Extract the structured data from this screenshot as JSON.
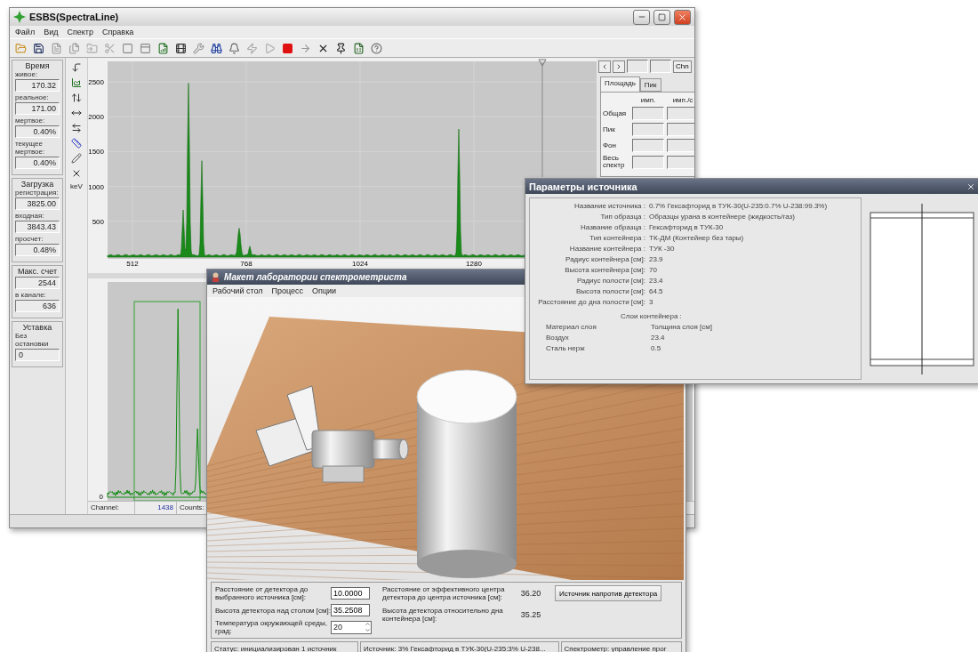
{
  "main_window": {
    "title": "ESBS(SpectraLine)",
    "menu": [
      "Файл",
      "Вид",
      "Спектр",
      "Справка"
    ],
    "left_panel": {
      "groups": [
        {
          "title": "Время",
          "fields": [
            {
              "label": "живое:",
              "value": "170.32"
            },
            {
              "label": "реальное:",
              "value": "171.00"
            },
            {
              "label": "мертвое:",
              "value": "0.40%"
            },
            {
              "label": "текущее мертвое:",
              "value": "0.40%"
            }
          ]
        },
        {
          "title": "Загрузка",
          "fields": [
            {
              "label": "регистрация:",
              "value": "3825.00"
            },
            {
              "label": "входная:",
              "value": "3843.43"
            },
            {
              "label": "просчет:",
              "value": "0.48%"
            }
          ]
        },
        {
          "title": "Макс. счет",
          "fields": [
            {
              "value": "2544"
            },
            {
              "label": "в канале:",
              "value": "636"
            }
          ]
        },
        {
          "title": "Уставка",
          "fields": [
            {
              "label": "Без остановки",
              "value": "0"
            }
          ]
        }
      ]
    },
    "tool_column": {
      "unit_label": "keV"
    },
    "upper_chart": {
      "y_tick_labels": [
        "2500",
        "2000",
        "1500",
        "1000",
        "500"
      ],
      "x_tick_labels": [
        "512",
        "768",
        "1024",
        "1280"
      ]
    },
    "lower_chart": {
      "y_tick_labels": [
        "0"
      ],
      "channel_label": "Channel:",
      "channel_value": "1438",
      "counts_label": "Counts:"
    },
    "side_panel": {
      "button": "Chn",
      "tabs": [
        {
          "label": "Площадь",
          "selected": true
        },
        {
          "label": "Пик",
          "selected": false
        }
      ],
      "columns": [
        "имп.",
        "имп./с"
      ],
      "rows": [
        "Общая",
        "Пик",
        "Фон",
        "Весь спектр"
      ]
    }
  },
  "params_window": {
    "title": "Параметры источника",
    "rows": [
      {
        "label": "Название источника :",
        "value": "0.7% Гексафторид в ТУК-30(U-235:0.7% U-238:99.3%)"
      },
      {
        "label": "Тип образца :",
        "value": "Образцы урана в контейнере (жидкость/газ)"
      },
      {
        "label": "Название образца :",
        "value": "Гексафторид в ТУК-30"
      },
      {
        "label": "Тип контейнера :",
        "value": "ТК-ДМ (Контейнер без тары)"
      },
      {
        "label": "Название контейнера :",
        "value": "ТУК -30"
      },
      {
        "label": "Радиус контейнера [см]:",
        "value": "23.9"
      },
      {
        "label": "Высота контейнера [см]:",
        "value": "70"
      },
      {
        "label": "Радиус полости [см]:",
        "value": "23.4"
      },
      {
        "label": "Высота полости [см]:",
        "value": "64.5"
      },
      {
        "label": "Расстояние до дна полости [см]:",
        "value": "3"
      }
    ],
    "layers_title": "Слои контейнера :",
    "layer_columns": [
      "Материал слоя",
      "Толщина слоя [см]"
    ],
    "layers": [
      {
        "material": "Воздух",
        "thickness": "23.4"
      },
      {
        "material": "Сталь нерж",
        "thickness": "0.5"
      }
    ]
  },
  "lab_window": {
    "title": "Макет лаборатории спектрометриста",
    "menu": [
      "Рабочий стол",
      "Процесс",
      "Опции"
    ],
    "inputs": [
      {
        "label": "Расстояние от детектора до выбранного источника [см]:",
        "value": "10.0000",
        "kind": "text"
      },
      {
        "label": "Высота детектора над столом [см]:",
        "value": "35.2508",
        "kind": "text"
      },
      {
        "label": "Температура окружающей среды, град:",
        "value": "20",
        "kind": "spinner"
      }
    ],
    "readouts": [
      {
        "label": "Расстояние от эффективного центра детектора до центра источника [см]:",
        "value": "36.20"
      },
      {
        "label": "Высота детектора относительно дна контейнера [см]:",
        "value": "35.25"
      }
    ],
    "button": "Источник напротив детектора",
    "status_bar": [
      "Статус: инициализирован 1 источник",
      "Источник: 3% Гексафторид в ТУК-30(U-235:3% U-238...",
      "Спектрометр: управление прог"
    ]
  }
}
